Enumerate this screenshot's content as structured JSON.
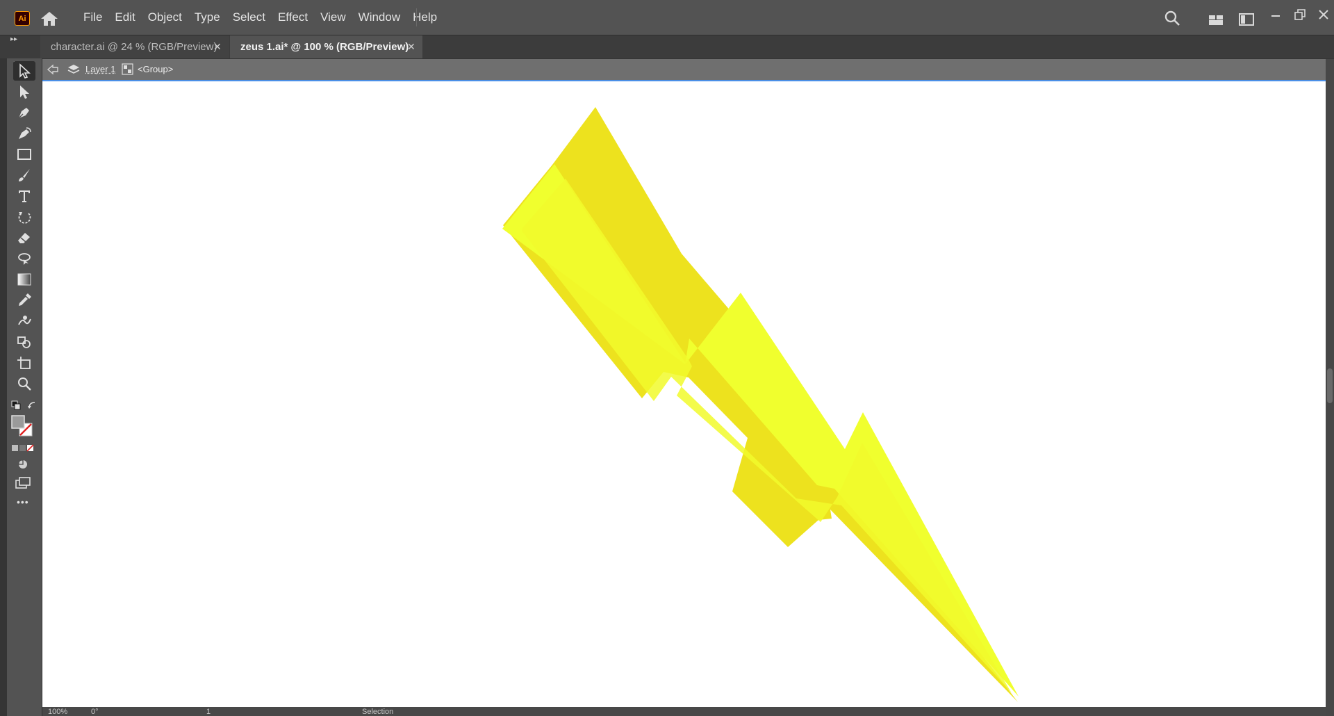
{
  "app": {
    "logo_text": "Ai",
    "menu": [
      "File",
      "Edit",
      "Object",
      "Type",
      "Select",
      "Effect",
      "View",
      "Window",
      "Help"
    ]
  },
  "tabs": [
    {
      "label": "character.ai @ 24 % (RGB/Preview)",
      "close": "✕",
      "active": false
    },
    {
      "label": "zeus 1.ai* @ 100 % (RGB/Preview)",
      "close": "✕",
      "active": true
    }
  ],
  "breadcrumb": {
    "layer": "Layer 1",
    "group": "<Group>"
  },
  "status": {
    "zoom": "100%",
    "rotation": "0°",
    "artboard": "1",
    "tool": "Selection"
  },
  "toolbar": {
    "more_label": "•••"
  },
  "colors": {
    "bolt_main": "#f0ff2e",
    "bolt_shadow": "#ede21e",
    "accent_line": "#4a8fe7",
    "panel": "#535353"
  },
  "icons": {
    "home": "home-icon",
    "search": "search-icon",
    "arrange": "arrange-documents-icon",
    "workspace": "workspace-switcher-icon",
    "minimize": "minimize-icon",
    "restore": "restore-icon",
    "close": "close-icon"
  }
}
